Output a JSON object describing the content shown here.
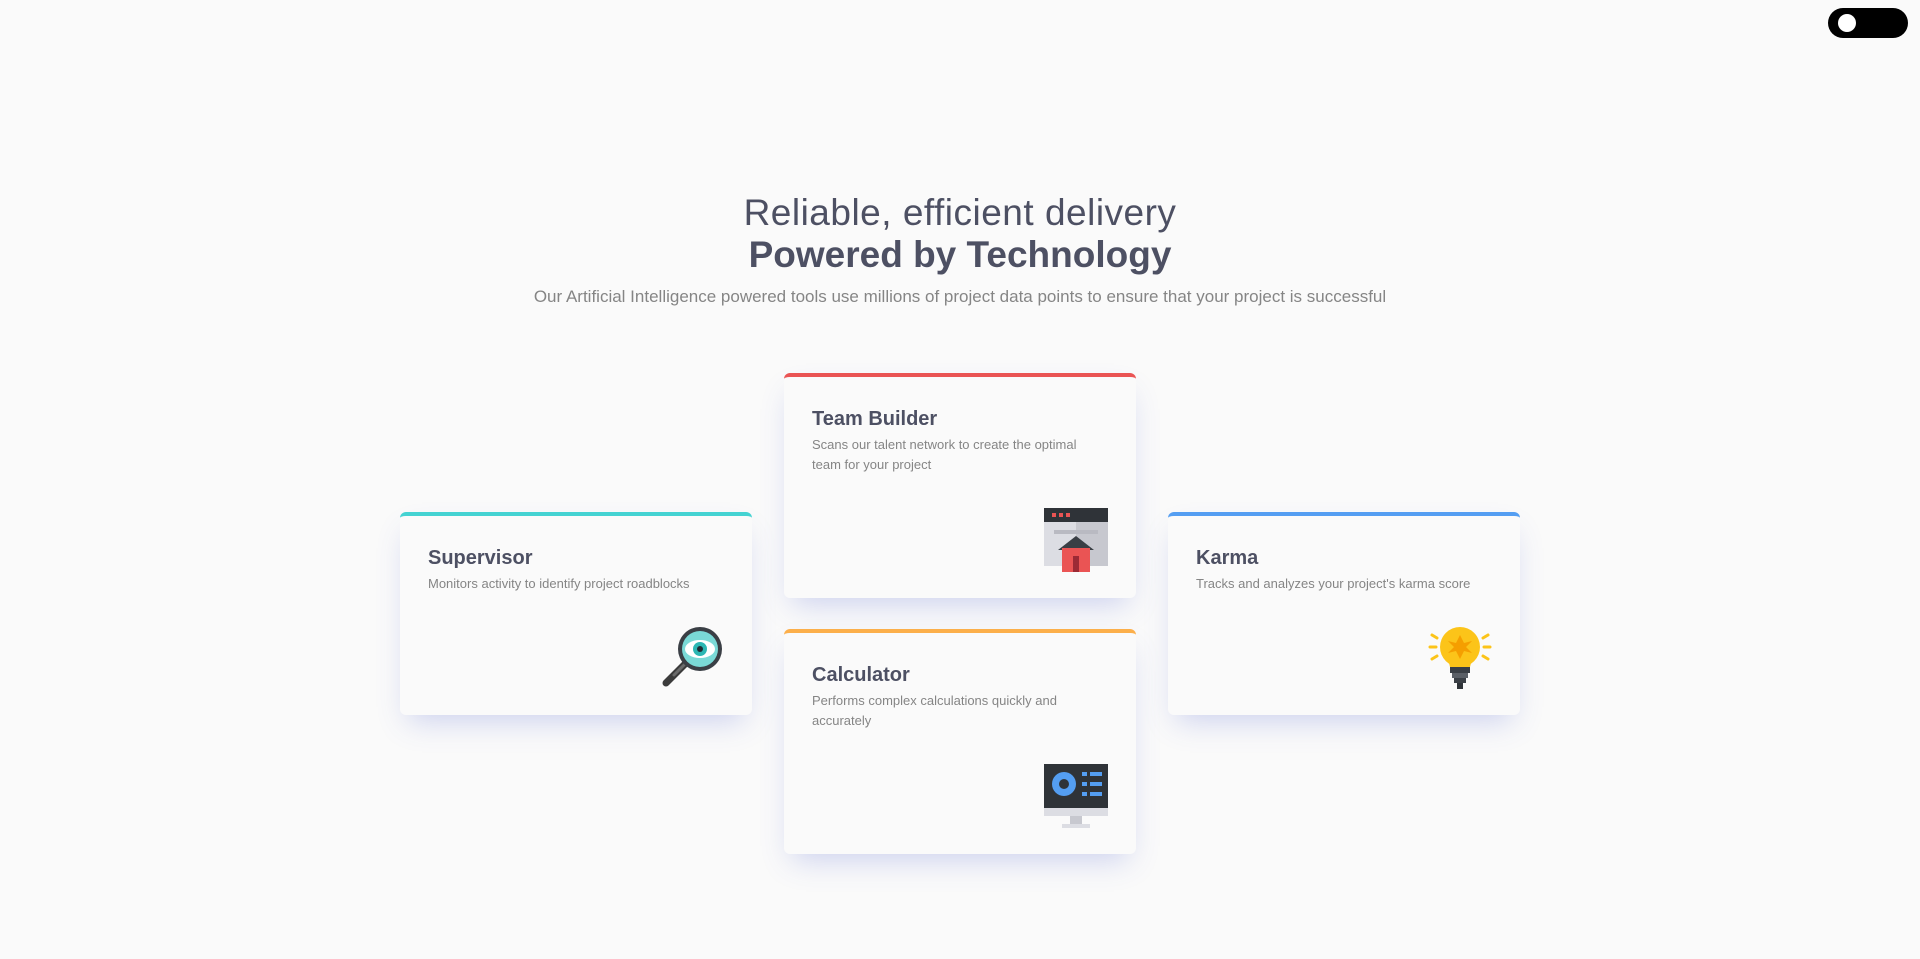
{
  "theme_toggle": {
    "state": "off"
  },
  "header": {
    "line1": "Reliable, efficient delivery",
    "line2": "Powered by Technology",
    "subtitle": "Our Artificial Intelligence powered tools use millions of project data points to ensure that your project is successful"
  },
  "cards": [
    {
      "title": "Supervisor",
      "description": "Monitors activity to identify project roadblocks",
      "accent": "#44d3d2",
      "icon": "magnifier-eye-icon"
    },
    {
      "title": "Team Builder",
      "description": "Scans our talent network to create the optimal team for your project",
      "accent": "#ea5454",
      "icon": "browser-house-icon"
    },
    {
      "title": "Calculator",
      "description": "Performs complex calculations quickly and accurately",
      "accent": "#fcaf4a",
      "icon": "monitor-chart-icon"
    },
    {
      "title": "Karma",
      "description": "Tracks and analyzes your project's karma score",
      "accent": "#549ef2",
      "icon": "lightbulb-icon"
    }
  ]
}
